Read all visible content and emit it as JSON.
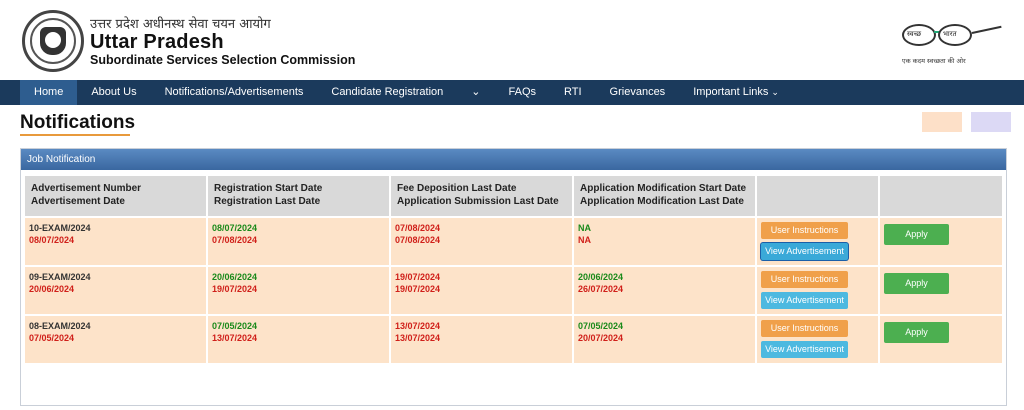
{
  "header": {
    "hindi_title": "उत्तर प्रदेश अधीनस्थ सेवा चयन आयोग",
    "title": "Uttar Pradesh",
    "subtitle": "Subordinate Services Selection Commission",
    "swachh_left": "स्वच्छ",
    "swachh_right": "भारत",
    "swachh_tagline": "एक कदम स्वच्छता की ओर"
  },
  "nav": {
    "items": [
      {
        "label": "Home"
      },
      {
        "label": "About Us"
      },
      {
        "label": "Notifications/Advertisements"
      },
      {
        "label": "Candidate Registration"
      },
      {
        "label": "⌄"
      },
      {
        "label": "FAQs"
      },
      {
        "label": "RTI"
      },
      {
        "label": "Grievances"
      },
      {
        "label": "Important Links"
      }
    ],
    "caret": "⌄"
  },
  "page": {
    "title": "Notifications",
    "panel_title": "Job Notification"
  },
  "colors": {
    "nav_bg": "#1b3a5c",
    "row_bg": "#fde3c9",
    "green": "#1a8a1a",
    "red": "#d0201a",
    "swatch_1": "#fde0c8",
    "swatch_2": "#dcd9f5"
  },
  "table": {
    "headers": [
      {
        "l1": "Advertisement Number",
        "l2": "Advertisement Date"
      },
      {
        "l1": "Registration Start Date",
        "l2": "Registration Last Date"
      },
      {
        "l1": "Fee Deposition Last Date",
        "l2": "Application Submission Last Date"
      },
      {
        "l1": "Application Modification Start Date",
        "l2": "Application Modification Last Date"
      },
      {
        "l1": "",
        "l2": ""
      },
      {
        "l1": "",
        "l2": ""
      }
    ],
    "user_instructions_label": "User Instructions",
    "view_advertisement_label": "View Advertisement",
    "apply_label": "Apply",
    "rows": [
      {
        "adv_no": "10-EXAM/2024",
        "adv_date": "08/07/2024",
        "reg_start": "08/07/2024",
        "reg_last": "07/08/2024",
        "fee_last": "07/08/2024",
        "sub_last": "07/08/2024",
        "mod_start": "NA",
        "mod_last": "NA"
      },
      {
        "adv_no": "09-EXAM/2024",
        "adv_date": "20/06/2024",
        "reg_start": "20/06/2024",
        "reg_last": "19/07/2024",
        "fee_last": "19/07/2024",
        "sub_last": "19/07/2024",
        "mod_start": "20/06/2024",
        "mod_last": "26/07/2024"
      },
      {
        "adv_no": "08-EXAM/2024",
        "adv_date": "07/05/2024",
        "reg_start": "07/05/2024",
        "reg_last": "13/07/2024",
        "fee_last": "13/07/2024",
        "sub_last": "13/07/2024",
        "mod_start": "07/05/2024",
        "mod_last": "20/07/2024"
      }
    ]
  }
}
